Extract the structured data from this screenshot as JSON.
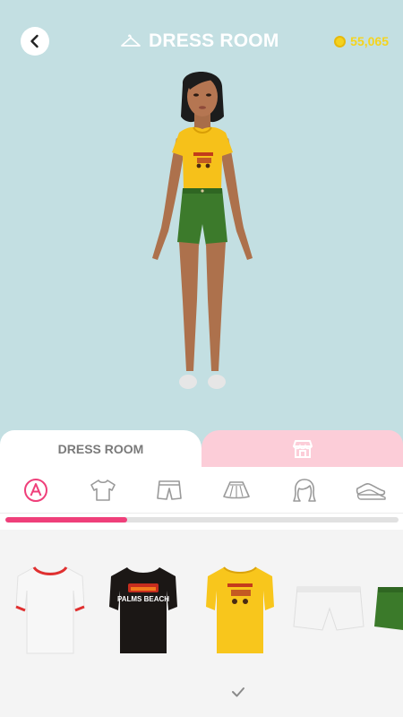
{
  "header": {
    "title": "DRESS ROOM",
    "coins": "55,065",
    "back_icon": "chevron-left-icon",
    "title_icon": "hanger-icon",
    "coin_icon": "coin-icon"
  },
  "tabs": {
    "dress_room_label": "DRESS ROOM",
    "shop_icon": "store-icon"
  },
  "categories": [
    {
      "name": "category-all",
      "icon": "letter-a-icon"
    },
    {
      "name": "category-tops",
      "icon": "tshirt-icon"
    },
    {
      "name": "category-shorts",
      "icon": "shorts-icon"
    },
    {
      "name": "category-skirts",
      "icon": "skirt-icon"
    },
    {
      "name": "category-hair",
      "icon": "hair-icon"
    },
    {
      "name": "category-shoes",
      "icon": "shoes-icon"
    }
  ],
  "scroll_progress": 0.31,
  "items": [
    {
      "name": "white-tshirt-red-trim",
      "print_text": ""
    },
    {
      "name": "black-tshirt-palms-beach",
      "print_text": "PALMS BEACH"
    },
    {
      "name": "yellow-tshirt-plane-print",
      "print_text": ""
    },
    {
      "name": "white-denim-shorts",
      "print_text": ""
    },
    {
      "name": "green-denim-shorts",
      "print_text": ""
    }
  ],
  "colors": {
    "background": "#c3dfe2",
    "accent_pink": "#ef3f7a",
    "shop_tab": "#fccdd8",
    "coin_yellow": "#f5d41c"
  }
}
